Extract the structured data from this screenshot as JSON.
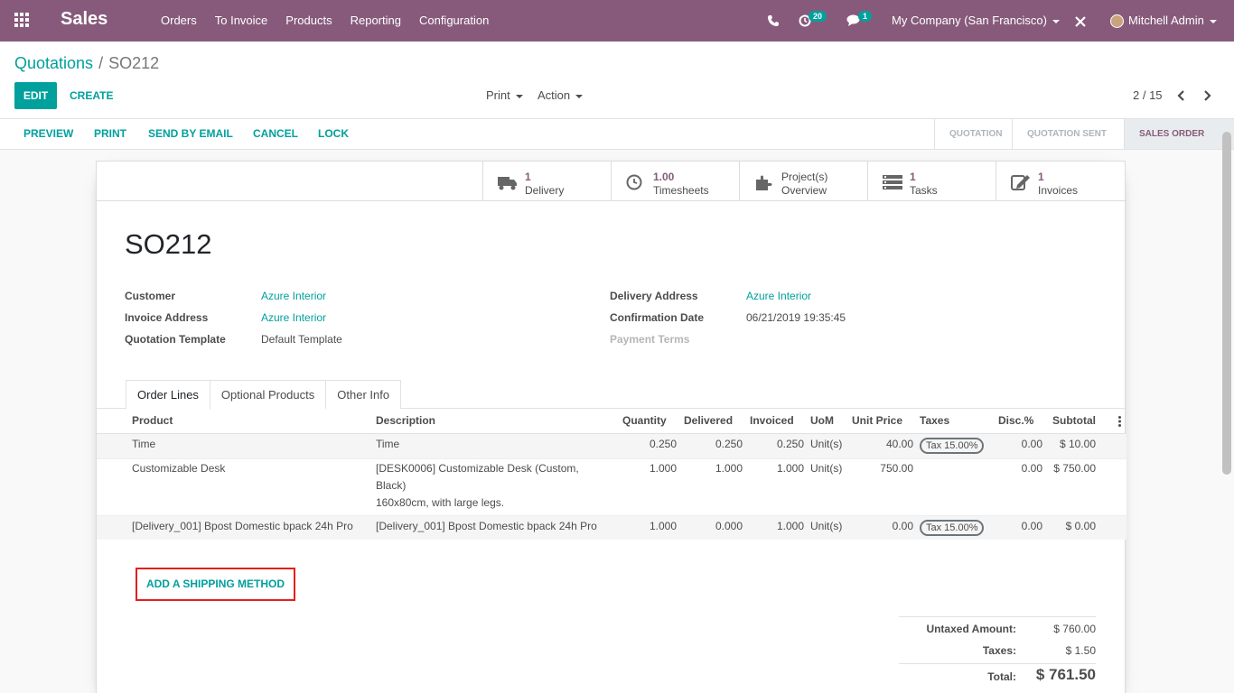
{
  "navbar": {
    "brand": "Sales",
    "menu": [
      "Orders",
      "To Invoice",
      "Products",
      "Reporting",
      "Configuration"
    ],
    "activity_count": "20",
    "message_count": "1",
    "company": "My Company (San Francisco)",
    "user": "Mitchell Admin"
  },
  "breadcrumb": {
    "parent": "Quotations",
    "separator": "/",
    "current": "SO212"
  },
  "controls": {
    "edit": "EDIT",
    "create": "CREATE",
    "print": "Print",
    "action": "Action",
    "pager": "2 / 15"
  },
  "statusbar": {
    "buttons": [
      "PREVIEW",
      "PRINT",
      "SEND BY EMAIL",
      "CANCEL",
      "LOCK"
    ],
    "stages": [
      "QUOTATION",
      "QUOTATION SENT",
      "SALES ORDER"
    ]
  },
  "smart_buttons": [
    {
      "value": "1",
      "label": "Delivery",
      "icon": "truck-icon"
    },
    {
      "value": "1.00",
      "label": "Timesheets",
      "icon": "clock-icon"
    },
    {
      "value": "Project(s)",
      "label": "Overview",
      "icon": "puzzle-icon"
    },
    {
      "value": "1",
      "label": "Tasks",
      "icon": "tasks-icon"
    },
    {
      "value": "1",
      "label": "Invoices",
      "icon": "invoice-icon"
    }
  ],
  "order": {
    "name": "SO212",
    "fields_left": [
      {
        "label": "Customer",
        "value": "Azure Interior"
      },
      {
        "label": "Invoice Address",
        "value": "Azure Interior"
      },
      {
        "label": "Quotation Template",
        "value": "Default Template"
      }
    ],
    "fields_right": [
      {
        "label": "Delivery Address",
        "value": "Azure Interior"
      },
      {
        "label": "Confirmation Date",
        "value": "06/21/2019 19:35:45"
      },
      {
        "label": "Payment Terms",
        "value": ""
      }
    ]
  },
  "tabs": [
    "Order Lines",
    "Optional Products",
    "Other Info"
  ],
  "table": {
    "headers": [
      "Product",
      "Description",
      "Quantity",
      "Delivered",
      "Invoiced",
      "UoM",
      "Unit Price",
      "Taxes",
      "Disc.%",
      "Subtotal"
    ],
    "rows": [
      {
        "product": "Time",
        "desc1": "Time",
        "desc2": "",
        "desc3": "",
        "qty": "0.250",
        "delivered": "0.250",
        "invoiced": "0.250",
        "uom": "Unit(s)",
        "price": "40.00",
        "tax": "Tax 15.00%",
        "disc": "0.00",
        "subtotal": "$ 10.00"
      },
      {
        "product": "Customizable Desk",
        "desc1": "[DESK0006] Customizable Desk (Custom,",
        "desc2": "Black)",
        "desc3": "160x80cm, with large legs.",
        "qty": "1.000",
        "delivered": "1.000",
        "invoiced": "1.000",
        "uom": "Unit(s)",
        "price": "750.00",
        "tax": "",
        "disc": "0.00",
        "subtotal": "$ 750.00"
      },
      {
        "product": "[Delivery_001] Bpost Domestic bpack 24h Pro",
        "desc1": "[Delivery_001] Bpost Domestic bpack 24h Pro",
        "desc2": "",
        "desc3": "",
        "qty": "1.000",
        "delivered": "0.000",
        "invoiced": "1.000",
        "uom": "Unit(s)",
        "price": "0.00",
        "tax": "Tax 15.00%",
        "disc": "0.00",
        "subtotal": "$ 0.00"
      }
    ]
  },
  "shipping_button": "ADD A SHIPPING METHOD",
  "totals": {
    "untaxed_label": "Untaxed Amount:",
    "untaxed": "$ 760.00",
    "taxes_label": "Taxes:",
    "taxes": "$ 1.50",
    "total_label": "Total:",
    "total": "$ 761.50"
  },
  "colors": {
    "brand": "#875a7b",
    "accent": "#00a09d",
    "highlight": "#e41e1e"
  }
}
